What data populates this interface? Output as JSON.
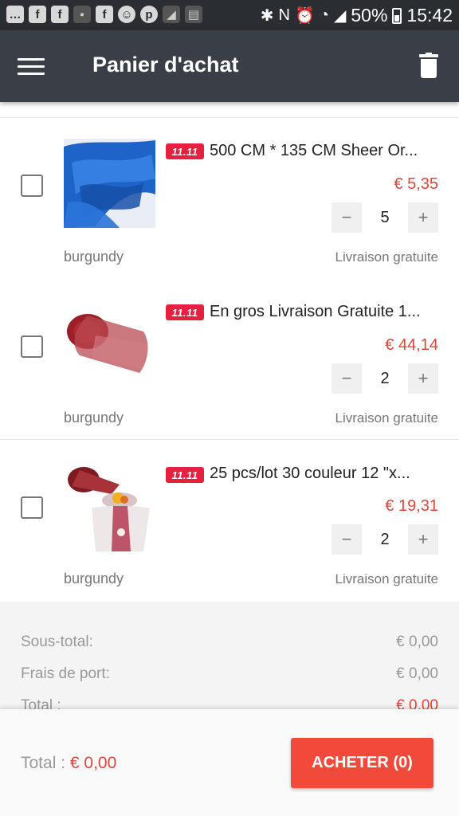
{
  "status_bar": {
    "battery": "50%",
    "time": "15:42",
    "left_icons": [
      "message-icon",
      "facebook-icon",
      "facebook-icon",
      "image-icon",
      "facebook-icon",
      "emoji-icon",
      "pinterest-icon",
      "photo-icon",
      "news-icon"
    ],
    "right_icons": [
      "bluetooth-icon",
      "nfc-icon",
      "alarm-icon",
      "wifi-icon",
      "signal-icon",
      "battery-icon"
    ]
  },
  "app_bar": {
    "title": "Panier d'achat",
    "menu_icon": "hamburger-menu-icon",
    "delete_icon": "trash-icon"
  },
  "items": [
    {
      "badge": "11.11",
      "title": "500 CM * 135 CM Sheer Or...",
      "price": "€ 5,35",
      "quantity": "5",
      "variant": "burgundy",
      "shipping": "Livraison gratuite",
      "image": "blue organza fabric"
    },
    {
      "badge": "11.11",
      "title": "En gros Livraison Gratuite 1...",
      "price": "€ 44,14",
      "quantity": "2",
      "variant": "burgundy",
      "shipping": "Livraison gratuite",
      "image": "burgundy organza roll"
    },
    {
      "badge": "11.11",
      "title": "25 pcs/lot 30 couleur 12 \"x...",
      "price": "€ 19,31",
      "quantity": "2",
      "variant": "burgundy",
      "shipping": "Livraison gratuite",
      "image": "burgundy table runner on cocktail table"
    }
  ],
  "stepper": {
    "minus": "−",
    "plus": "+"
  },
  "summary": {
    "subtotal_label": "Sous-total:",
    "subtotal_value": "€ 0,00",
    "shipping_label": "Frais de port:",
    "shipping_value": "€ 0,00",
    "total_label": "Total :",
    "total_value": "€ 0,00"
  },
  "bottom": {
    "total_label": "Total : ",
    "total_value": "€ 0,00",
    "buy_label": "ACHETER (0)"
  },
  "colors": {
    "app_bar": "#3a3f47",
    "status_bar": "#2a2d31",
    "accent_red": "#e0463a",
    "buy_button": "#f24a3a",
    "badge": "#e6213f"
  }
}
